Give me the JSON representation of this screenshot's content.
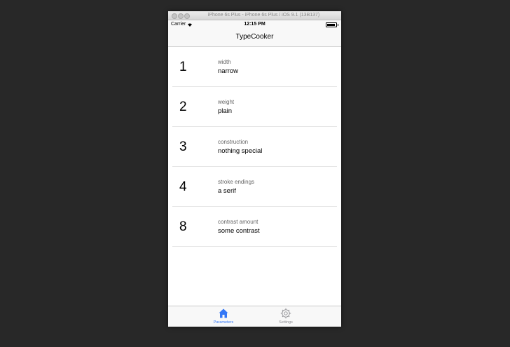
{
  "window": {
    "title": "iPhone 6s Plus - iPhone 6s Plus / iOS 9.1 (13B137)"
  },
  "status_bar": {
    "carrier": "Carrier",
    "time": "12:15 PM"
  },
  "nav_bar": {
    "title": "TypeCooker"
  },
  "rows": [
    {
      "number": "1",
      "label": "width",
      "value": "narrow"
    },
    {
      "number": "2",
      "label": "weight",
      "value": "plain"
    },
    {
      "number": "3",
      "label": "construction",
      "value": "nothing special"
    },
    {
      "number": "4",
      "label": "stroke endings",
      "value": "a serif"
    },
    {
      "number": "8",
      "label": "contrast amount",
      "value": "some contrast"
    }
  ],
  "tab_bar": {
    "tabs": [
      {
        "label": "Parameters",
        "icon": "home-icon",
        "selected": true
      },
      {
        "label": "Settings",
        "icon": "gear-icon",
        "selected": false
      }
    ]
  },
  "colors": {
    "background": "#282828",
    "accent": "#3478f6",
    "inactive": "#8e8e93"
  }
}
